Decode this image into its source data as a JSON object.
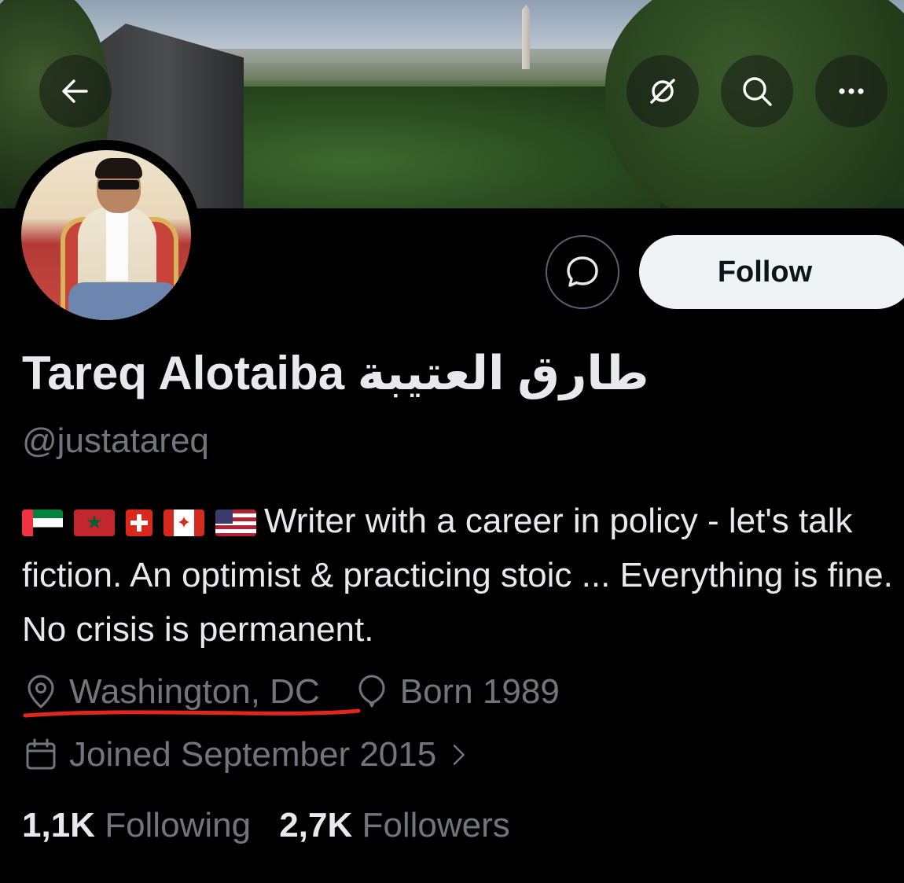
{
  "header": {
    "back_icon": "back-arrow-icon",
    "grok_icon": "grok-icon",
    "search_icon": "search-icon",
    "more_icon": "more-icon"
  },
  "actions": {
    "message_icon": "message-bubble-icon",
    "follow_label": "Follow"
  },
  "profile": {
    "name": "Tareq Alotaiba طارق العتيبة",
    "handle": "@justatareq",
    "bio_flags": [
      "UAE",
      "Morocco",
      "Switzerland",
      "Canada",
      "USA"
    ],
    "bio": "Writer with a career in policy - let's talk fiction. An optimist & practicing stoic ... Everything is fine. No crisis is permanent.",
    "location": "Washington, DC",
    "born": "Born 1989",
    "joined": "Joined September 2015"
  },
  "stats": {
    "following_count": "1,1K",
    "following_label": "Following",
    "followers_count": "2,7K",
    "followers_label": "Followers"
  },
  "colors": {
    "background": "#000000",
    "text": "#e7e9ea",
    "secondary_text": "#71767b",
    "follow_button": "#eff3f4",
    "annotation_underline": "#e0261e"
  }
}
